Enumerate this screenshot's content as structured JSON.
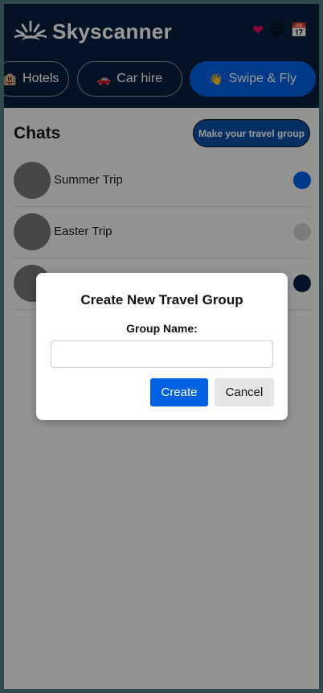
{
  "header": {
    "brand": "Skyscanner",
    "icons": [
      "heart-icon",
      "emoji-face-icon",
      "calendar-icon"
    ],
    "icon_glyphs": {
      "heart": "❤",
      "face": "😜",
      "calendar": "📅"
    },
    "brand_color": "#05203c"
  },
  "tabs": [
    {
      "label": "Hotels",
      "icon": "hotel-icon",
      "glyph": "🏨"
    },
    {
      "label": "Car hire",
      "icon": "car-icon",
      "glyph": "🚗"
    },
    {
      "label": "Swipe & Fly",
      "icon": "waving-hand-icon",
      "glyph": "👋",
      "active": true
    }
  ],
  "chats": {
    "title": "Chats",
    "make_group_label": "Make your travel group",
    "items": [
      {
        "name": "Summer Trip",
        "status_color": "#0062e3"
      },
      {
        "name": "Easter Trip",
        "status_color": "#cfcfcf"
      },
      {
        "name": "",
        "status_color": "#05203c"
      }
    ]
  },
  "modal": {
    "title": "Create New Travel Group",
    "label": "Group Name:",
    "input_value": "",
    "input_placeholder": "",
    "create_label": "Create",
    "cancel_label": "Cancel"
  },
  "colors": {
    "accent": "#0062e3",
    "overlay": "rgba(0,0,0,0.4)"
  }
}
